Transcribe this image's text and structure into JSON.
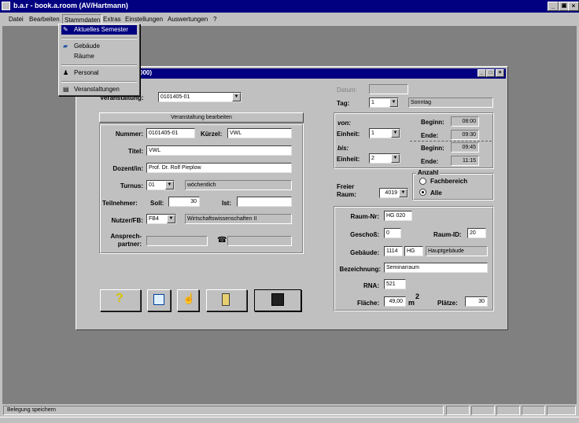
{
  "app": {
    "title": "b.a.r - book.a.room (AV/Hartmann)"
  },
  "menu": {
    "items": [
      "Datei",
      "Bearbeiten",
      "Stammdaten",
      "Extras",
      "Einstellungen",
      "Auswertungen",
      "?"
    ]
  },
  "dropdown": {
    "items": [
      {
        "label": "Aktuelles Semester",
        "icon": "calendar-icon"
      },
      {
        "label": "Gebäude",
        "icon": "building-icon"
      },
      {
        "label": "Räume",
        "icon": ""
      },
      {
        "label": "Personal",
        "icon": "person-icon"
      },
      {
        "label": "Veranstaltungen",
        "icon": "event-list-icon"
      }
    ]
  },
  "child": {
    "title_suffix": "000)",
    "veranstaltung_label": "Veranstaltung:",
    "veranstaltung_value": "0101405-01",
    "edit_button": "Veranstaltung bearbeiten",
    "nummer_label": "Nummer:",
    "nummer_value": "0101405-01",
    "kuerzel_label": "Kürzel:",
    "kuerzel_value": "VWL",
    "titel_label": "Titel:",
    "titel_value": "VWL",
    "dozent_label": "Dozent/in:",
    "dozent_value": "Prof. Dr. Rolf Pieplow",
    "turnus_label": "Turnus:",
    "turnus_value": "01",
    "turnus_text": "wöchentlich",
    "teilnehmer_label": "Teilnehmer:",
    "soll_label": "Soll:",
    "soll_value": "30",
    "ist_label": "Ist:",
    "ist_value": "",
    "nutzer_label": "Nutzer/FB:",
    "nutzer_value": "FB4",
    "nutzer_text": "Wirtschaftswissenschaften II",
    "ansprech_label1": "Ansprech-",
    "ansprech_label2": "partner:",
    "ansprech_value": "",
    "phone_value": "",
    "datum_label": "Datum:",
    "datum_value": "",
    "tag_label": "Tag:",
    "tag_value": "1",
    "tag_text": "Sonntag",
    "von_label": "von:",
    "von_einheit_label": "Einheit:",
    "von_einheit_value": "1",
    "von_beginn_label": "Beginn:",
    "von_beginn_value": "08:00",
    "von_ende_label": "Ende:",
    "von_ende_value": "09:30",
    "bis_label": "bis:",
    "bis_einheit_label": "Einheit:",
    "bis_einheit_value": "2",
    "bis_beginn_label": "Beginn:",
    "bis_beginn_value": "09:45",
    "bis_ende_label": "Ende:",
    "bis_ende_value": "11:15",
    "freier_label1": "Freier",
    "freier_label2": "Raum:",
    "freier_value": "4019",
    "anzahl_label": "Anzahl",
    "radio_fachbereich": "Fachbereich",
    "radio_alle": "Alle",
    "raumnr_label": "Raum-Nr:",
    "raumnr_value": "HG 020",
    "geschoss_label": "Geschoß:",
    "geschoss_value": "0",
    "raumid_label": "Raum-ID:",
    "raumid_value": "20",
    "gebaeude_label": "Gebäude:",
    "gebaeude_nr": "1114",
    "gebaeude_code": "HG",
    "gebaeude_text": "Hauptgebäude",
    "bezeichnung_label": "Bezeichnung:",
    "bezeichnung_value": "Seminarraum",
    "rna_label": "RNA:",
    "rna_value": "521",
    "flaeche_label": "Fläche:",
    "flaeche_value": "49,00",
    "flaeche_unit": "m",
    "flaeche_sup": "2",
    "plaetze_label": "Plätze:",
    "plaetze_value": "30"
  },
  "statusbar": {
    "text": "Belegung speichern"
  },
  "colors": {
    "titlebar": "#000080",
    "desktop": "#808080",
    "face": "#c0c0c0",
    "highlight": "#000080"
  }
}
